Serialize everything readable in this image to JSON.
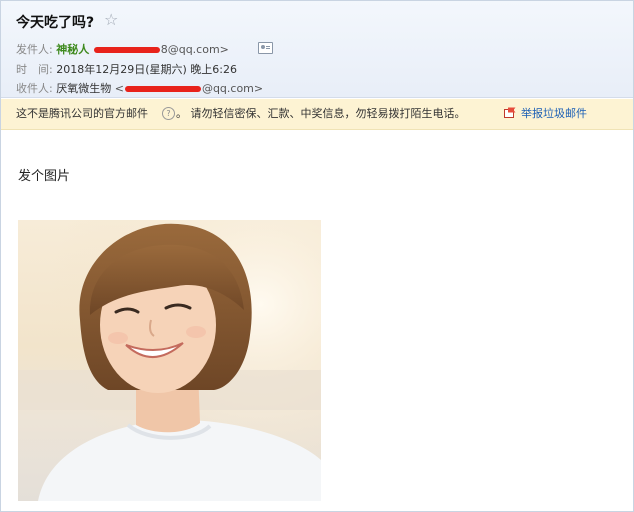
{
  "email": {
    "subject": "今天吃了吗?",
    "star_icon": "star-icon",
    "from_label": "发件人:",
    "from_name": "神秘人",
    "from_addr_suffix": "8@qq.com>",
    "time_label": "时　间:",
    "time_value": "2018年12月29日(星期六) 晚上6:26",
    "to_label": "收件人:",
    "to_name": "厌氧微生物",
    "to_addr_prefix": "<",
    "to_addr_suffix": "@qq.com>",
    "contact_card_icon": "contact-card-icon"
  },
  "warning": {
    "text_before": "这不是腾讯公司的官方邮件",
    "help_icon": "question-icon",
    "help_glyph": "?",
    "text_after": "。 请勿轻信密保、汇款、中奖信息，勿轻易拨打陌生电话。",
    "report_icon": "report-flag-icon",
    "report_link": "举报垃圾邮件"
  },
  "content": {
    "body": "发个图片",
    "image": "photo-of-smiling-woman"
  },
  "colors": {
    "header_bg": "#e8eef8",
    "sender_name": "#3f8a1f",
    "redaction": "#e8221b",
    "warning_bg": "#fdf3d3",
    "link": "#1b5fb5"
  }
}
